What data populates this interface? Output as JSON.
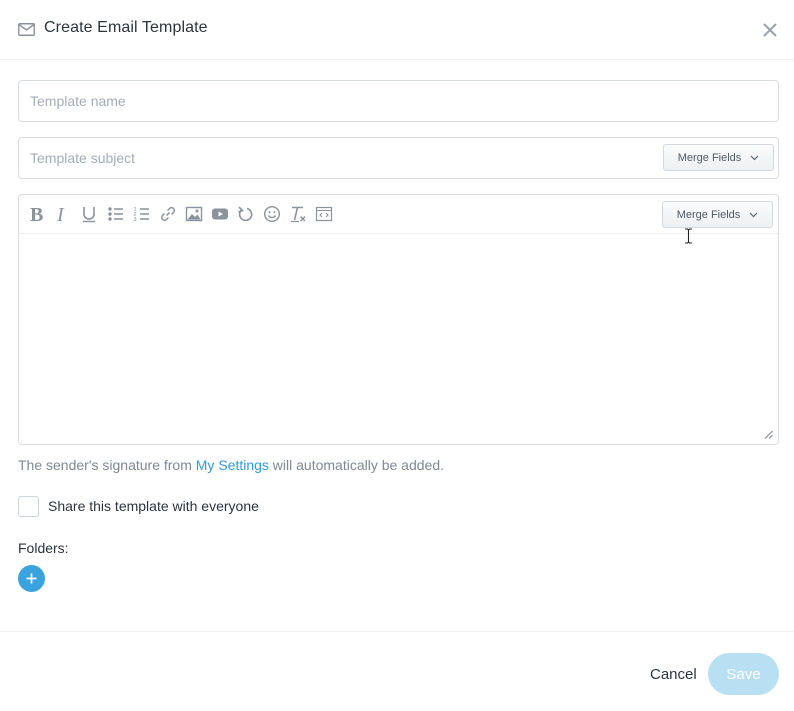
{
  "header": {
    "title": "Create Email Template",
    "icon": "mail-icon",
    "close_icon": "close-icon"
  },
  "form": {
    "name_placeholder": "Template name",
    "name_value": "",
    "subject_placeholder": "Template subject",
    "subject_value": "",
    "merge_fields_label": "Merge Fields"
  },
  "editor": {
    "toolbar": [
      {
        "name": "bold-icon"
      },
      {
        "name": "italic-icon"
      },
      {
        "name": "underline-icon"
      },
      {
        "name": "bulleted-list-icon"
      },
      {
        "name": "numbered-list-icon"
      },
      {
        "name": "link-icon"
      },
      {
        "name": "image-icon"
      },
      {
        "name": "video-icon"
      },
      {
        "name": "undo-icon"
      },
      {
        "name": "emoji-icon"
      },
      {
        "name": "clear-formatting-icon"
      },
      {
        "name": "source-code-icon"
      }
    ],
    "merge_fields_label": "Merge Fields",
    "content": ""
  },
  "signature_note": {
    "prefix": "The sender's signature from ",
    "link": "My Settings",
    "suffix": " will automatically be added."
  },
  "share": {
    "label": "Share this template with everyone",
    "checked": false
  },
  "folders": {
    "label": "Folders:",
    "add_icon": "plus-icon"
  },
  "footer": {
    "cancel_label": "Cancel",
    "save_label": "Save"
  },
  "colors": {
    "accent": "#3aa3dd",
    "link": "#2f9bd6",
    "save_disabled": "#b9dff3",
    "border": "#d7dce2",
    "muted_text": "#7f8893"
  }
}
